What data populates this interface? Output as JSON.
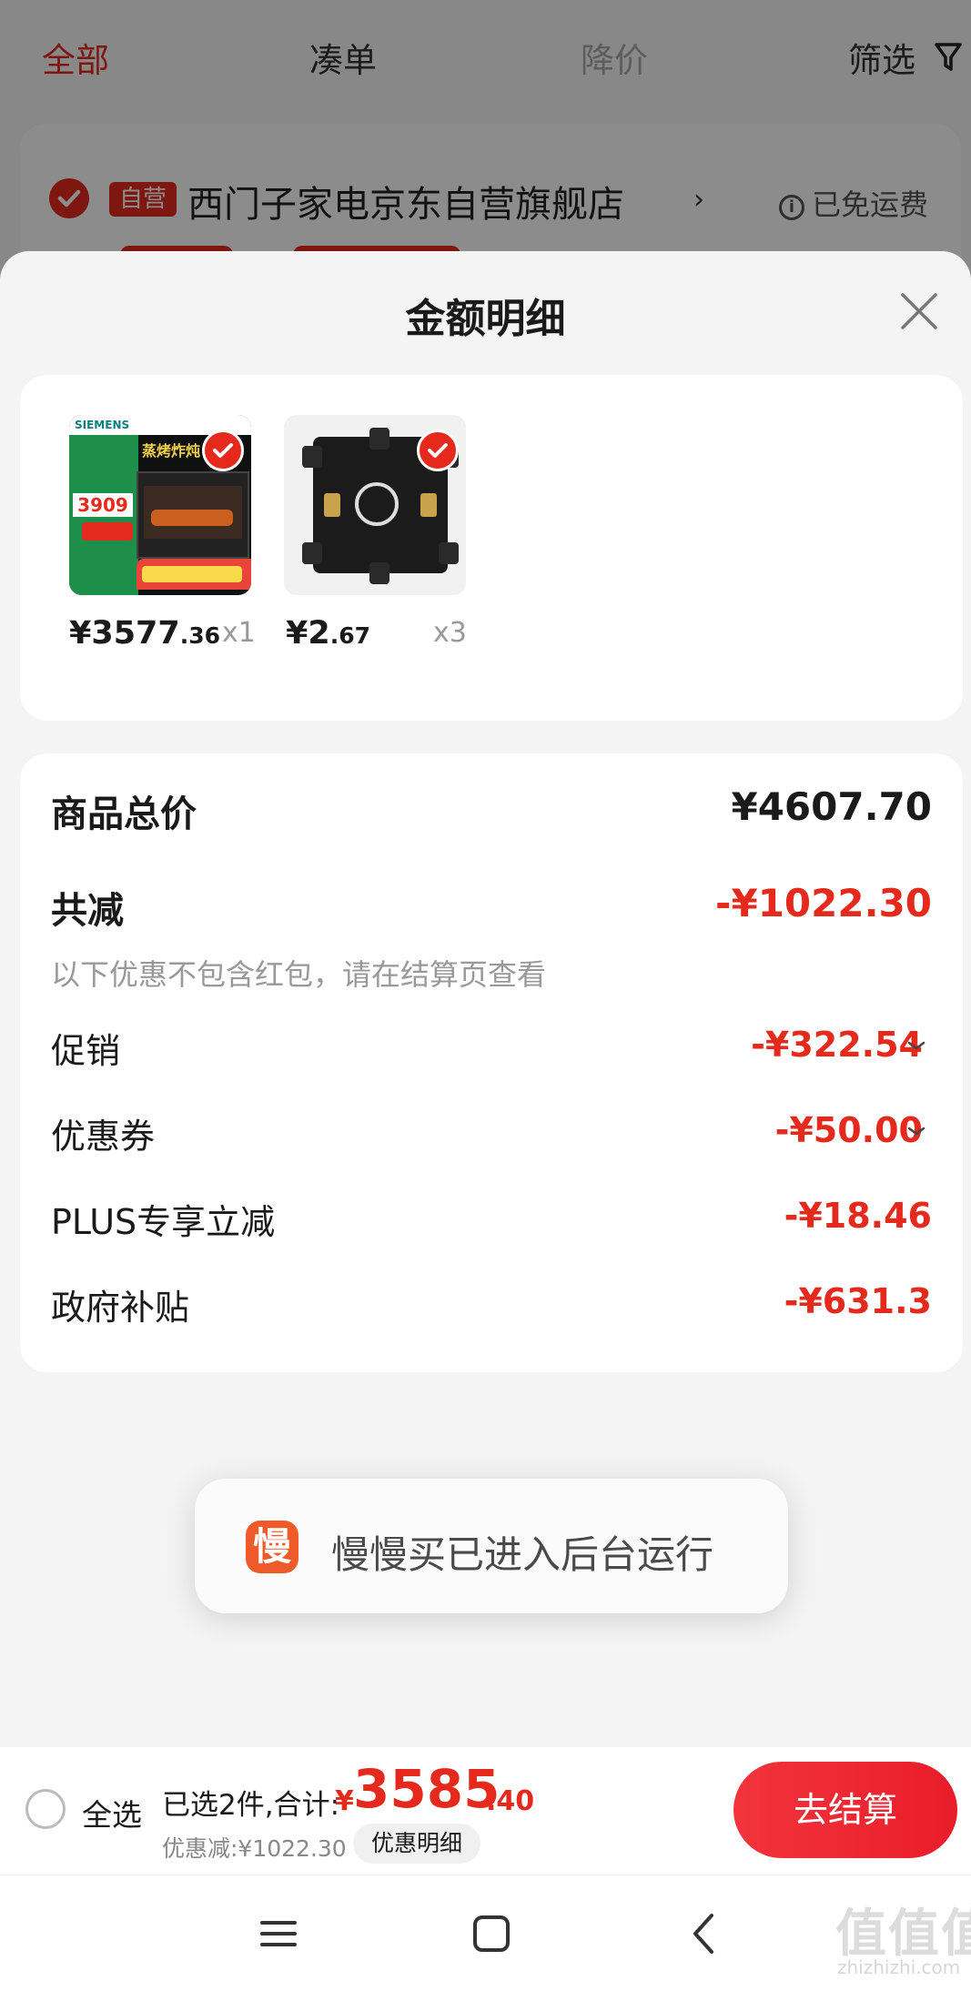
{
  "background_page": {
    "filter_tabs": [
      "全部",
      "凑单",
      "降价",
      "筛选"
    ],
    "store": {
      "badge": "自营",
      "name": "西门子家电京东自营旗舰店",
      "shipping": "已免运费"
    }
  },
  "sheet": {
    "title": "金额明细",
    "products": [
      {
        "image": "siemens-oven",
        "brand": "SIEMENS",
        "headline": "蒸烤炸炖",
        "promo_price": "3909",
        "price_int": "¥3577",
        "price_dec": ".36",
        "qty": "x1"
      },
      {
        "image": "junction-box",
        "price_int": "¥2",
        "price_dec": ".67",
        "qty": "x3"
      }
    ],
    "summary": {
      "total_label": "商品总价",
      "total_value": "¥4607.70",
      "reduction_label": "共减",
      "reduction_value": "-¥1022.30",
      "hint": "以下优惠不包含红包，请在结算页查看",
      "items": [
        {
          "label": "促销",
          "value": "-¥322.54",
          "expandable": true
        },
        {
          "label": "优惠券",
          "value": "-¥50.00",
          "expandable": true
        },
        {
          "label": "PLUS专享立减",
          "value": "-¥18.46",
          "expandable": false
        },
        {
          "label": "政府补贴",
          "value": "-¥631.3",
          "expandable": false
        }
      ]
    }
  },
  "toast": {
    "app_icon_char": "慢",
    "text": "慢慢买已进入后台运行"
  },
  "checkout": {
    "select_all": "全选",
    "selected_text": "已选2件,合计:",
    "currency": "¥",
    "total_int": "3585",
    "total_dec": ".40",
    "discount_text": "优惠减:¥1022.30",
    "detail_button": "优惠明细",
    "checkout_button": "去结算"
  },
  "watermark": {
    "main": "值值值",
    "sub": "zhizhizhi.com"
  },
  "colors": {
    "accent": "#e52a1d",
    "muted_text": "#999999",
    "card_bg": "#ffffff",
    "sheet_bg": "#f4f4f4"
  },
  "icons": [
    "funnel-icon",
    "check-icon",
    "info-icon",
    "close-icon",
    "chevron-down-icon",
    "menu-icon",
    "home-icon",
    "back-icon"
  ]
}
